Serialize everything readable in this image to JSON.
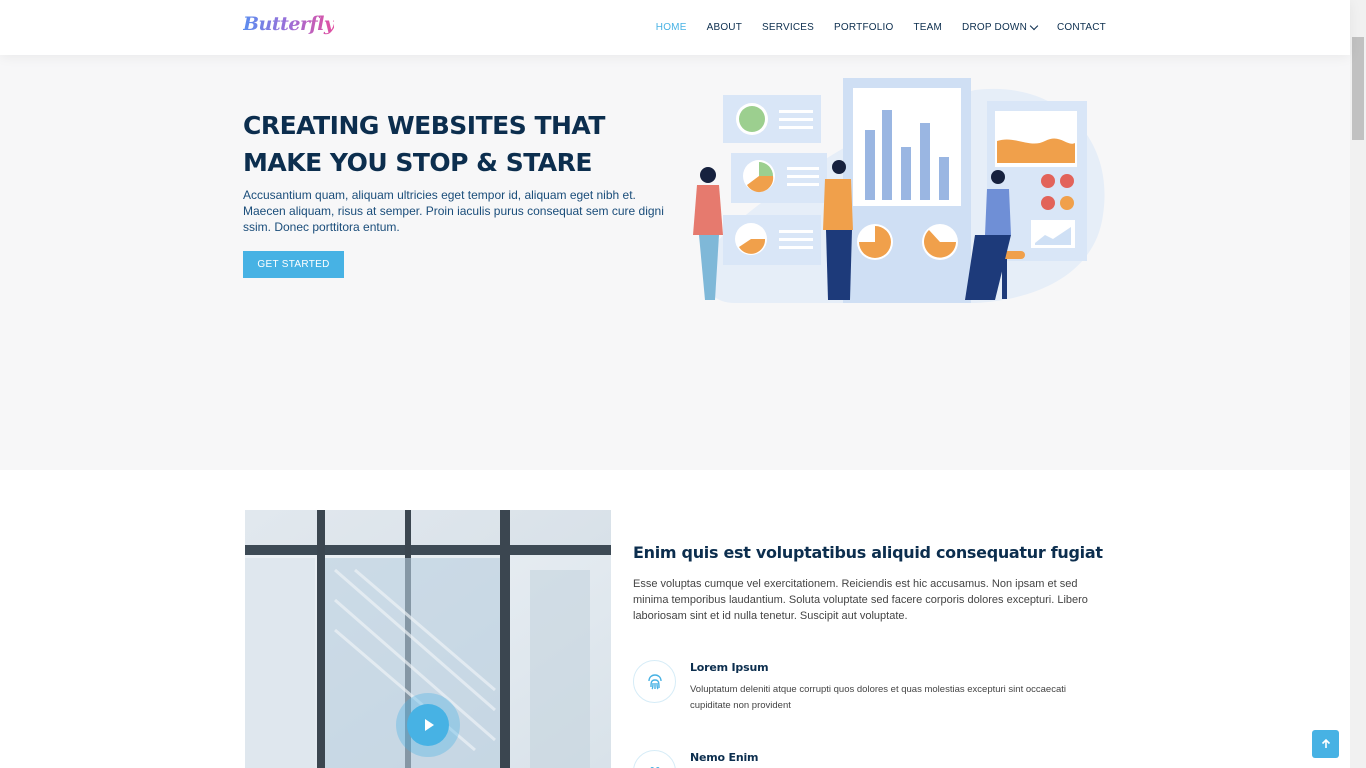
{
  "brand": {
    "logo": "Butterfly",
    "accent": "#47b2e4",
    "dark": "#0c2e4e"
  },
  "nav": {
    "items": [
      "HOME",
      "ABOUT",
      "SERVICES",
      "PORTFOLIO",
      "TEAM",
      "DROP DOWN",
      "CONTACT"
    ],
    "active": "HOME"
  },
  "hero": {
    "title": "CREATING WEBSITES THAT MAKE YOU STOP & STARE",
    "text": "Accusantium quam, aliquam ultricies eget tempor id, aliquam eget nibh et. Maecen aliquam, risus at semper. Proin iaculis purus consequat sem cure digni ssim. Donec porttitora entum.",
    "button": "GET STARTED"
  },
  "about": {
    "title": "Enim quis est voluptatibus aliquid consequatur fugiat",
    "text": "Esse voluptas cumque vel exercitationem. Reiciendis est hic accusamus. Non ipsam et sed minima temporibus laudantium. Soluta voluptate sed facere corporis dolores excepturi. Libero laboriosam sint et id nulla tenetur. Suscipit aut voluptate.",
    "features": [
      {
        "title": "Lorem Ipsum",
        "text": "Voluptatum deleniti atque corrupti quos dolores et quas molestias excepturi sint occaecati cupiditate non provident",
        "icon": "fingerprint-icon"
      },
      {
        "title": "Nemo Enim",
        "text": "",
        "icon": "gift-icon"
      }
    ]
  },
  "icons": {
    "play": "play-icon",
    "back_to_top": "arrow-up-icon",
    "dropdown": "chevron-down-icon"
  }
}
